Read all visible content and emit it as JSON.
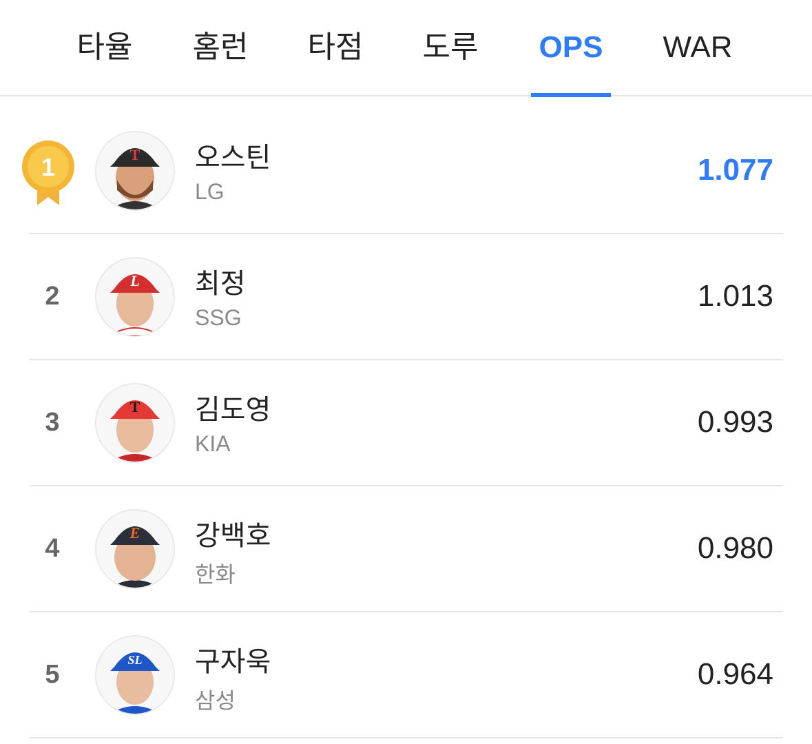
{
  "tabs": [
    {
      "label": "타율",
      "active": false
    },
    {
      "label": "홈런",
      "active": false
    },
    {
      "label": "타점",
      "active": false
    },
    {
      "label": "도루",
      "active": false
    },
    {
      "label": "OPS",
      "active": true
    },
    {
      "label": "WAR",
      "active": false
    }
  ],
  "colors": {
    "accent": "#2f7cf6",
    "medal_gold": "#f6b935",
    "divider": "#e6e6e6"
  },
  "rankings": [
    {
      "rank": "1",
      "name": "오스틴",
      "team": "LG",
      "value": "1.077",
      "medal": "gold-medal-icon",
      "cap_color": "#2a2a2a",
      "cap_logo": "T",
      "logo_color": "#e03a3a"
    },
    {
      "rank": "2",
      "name": "최정",
      "team": "SSG",
      "value": "1.013",
      "cap_color": "#d32f2f",
      "cap_logo": "L",
      "logo_color": "#ffffff"
    },
    {
      "rank": "3",
      "name": "김도영",
      "team": "KIA",
      "value": "0.993",
      "cap_color": "#e53935",
      "cap_logo": "T",
      "logo_color": "#1a1a1a"
    },
    {
      "rank": "4",
      "name": "강백호",
      "team": "한화",
      "value": "0.980",
      "cap_color": "#2b2f3a",
      "cap_logo": "E",
      "logo_color": "#f26b21"
    },
    {
      "rank": "5",
      "name": "구자욱",
      "team": "삼성",
      "value": "0.964",
      "cap_color": "#1f56c8",
      "cap_logo": "SL",
      "logo_color": "#ffffff"
    }
  ]
}
